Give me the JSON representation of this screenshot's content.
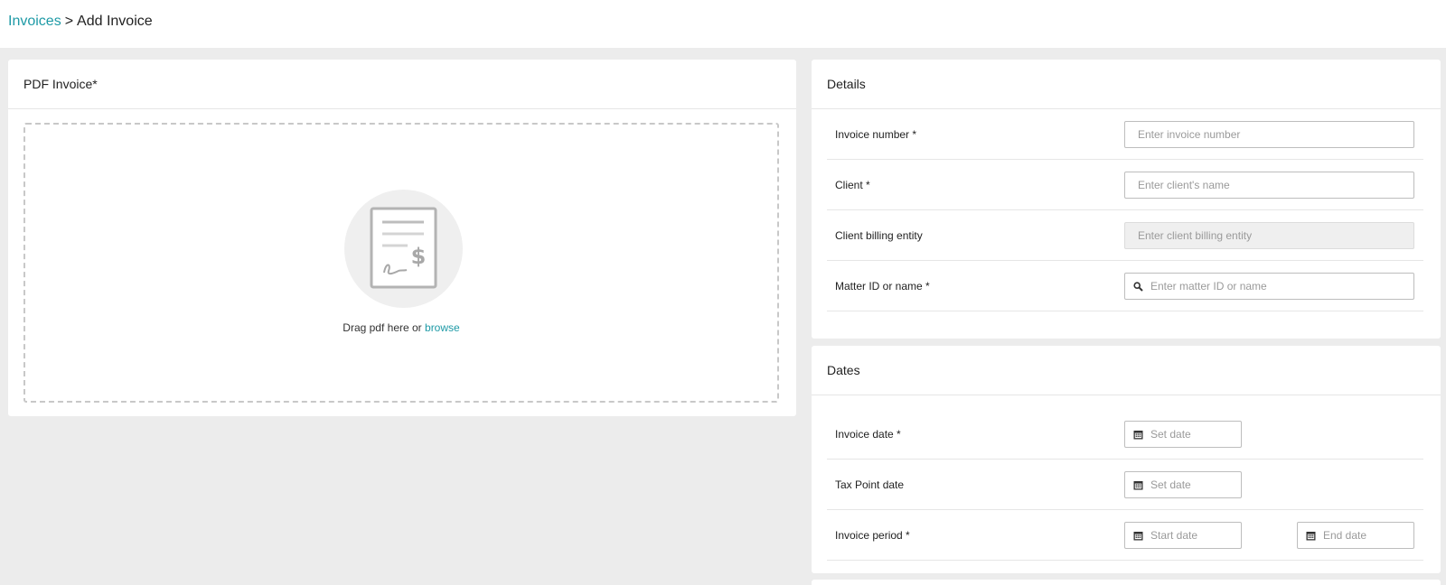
{
  "breadcrumb": {
    "parent": "Invoices",
    "separator": ">",
    "current": "Add Invoice"
  },
  "pdf_section": {
    "title": "PDF Invoice*",
    "drop_text": "Drag pdf here or",
    "browse_link": "browse",
    "icon": "invoice-document-icon"
  },
  "details": {
    "title": "Details",
    "fields": [
      {
        "label": "Invoice number *",
        "placeholder": "Enter invoice number",
        "value": ""
      },
      {
        "label": "Client *",
        "placeholder": "Enter client's name",
        "value": ""
      },
      {
        "label": "Client billing entity",
        "placeholder": "Enter client billing entity",
        "value": "",
        "disabled": true
      },
      {
        "label": "Matter ID or name *",
        "placeholder": "Enter matter ID or name",
        "value": "",
        "icon": "search-icon"
      }
    ]
  },
  "dates": {
    "title": "Dates",
    "fields": [
      {
        "label": "Invoice date *",
        "placeholder": "Set date",
        "icon": "calendar-icon"
      },
      {
        "label": "Tax Point date",
        "placeholder": "Set date",
        "icon": "calendar-icon"
      },
      {
        "label": "Invoice period *",
        "start_placeholder": "Start date",
        "end_placeholder": "End date",
        "icon": "calendar-icon"
      }
    ]
  },
  "colors": {
    "accent": "#1e9aa6",
    "background": "#ececec",
    "card": "#ffffff",
    "border": "#bdbdbd"
  }
}
